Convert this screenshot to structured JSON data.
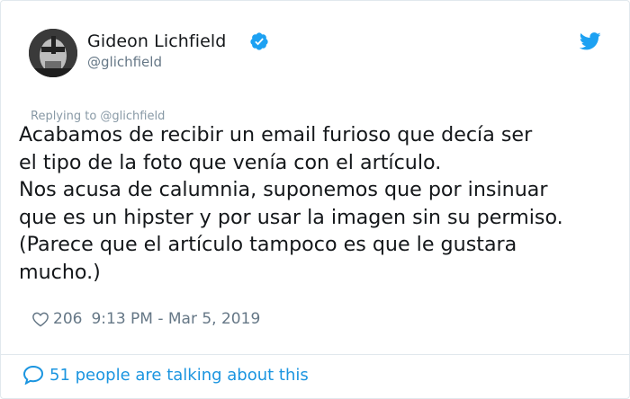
{
  "author": {
    "display_name": "Gideon Lichfield",
    "handle": "@glichfield",
    "verified": true
  },
  "reply_context": "Replying to @glichfield",
  "tweet": {
    "text": "Acabamos de recibir un email furioso que decía ser\nel tipo de la foto que venía con el artículo.\nNos acusa de calumnia, suponemos que por insinuar\nque es un hipster y por usar la imagen sin su permiso.\n(Parece que el artículo tampoco es que le gustara\nmucho.)",
    "likes": "206",
    "timestamp": "9:13 PM - Mar 5, 2019"
  },
  "footer": {
    "conversation": "51 people are talking about this"
  },
  "icons": {
    "verified": "verified-badge-icon",
    "platform": "twitter-bird-icon",
    "like": "heart-icon",
    "conversation": "speech-bubble-icon"
  },
  "colors": {
    "brand_blue": "#1da1f2",
    "link_blue": "#1b95e0",
    "secondary_text": "#657786"
  }
}
